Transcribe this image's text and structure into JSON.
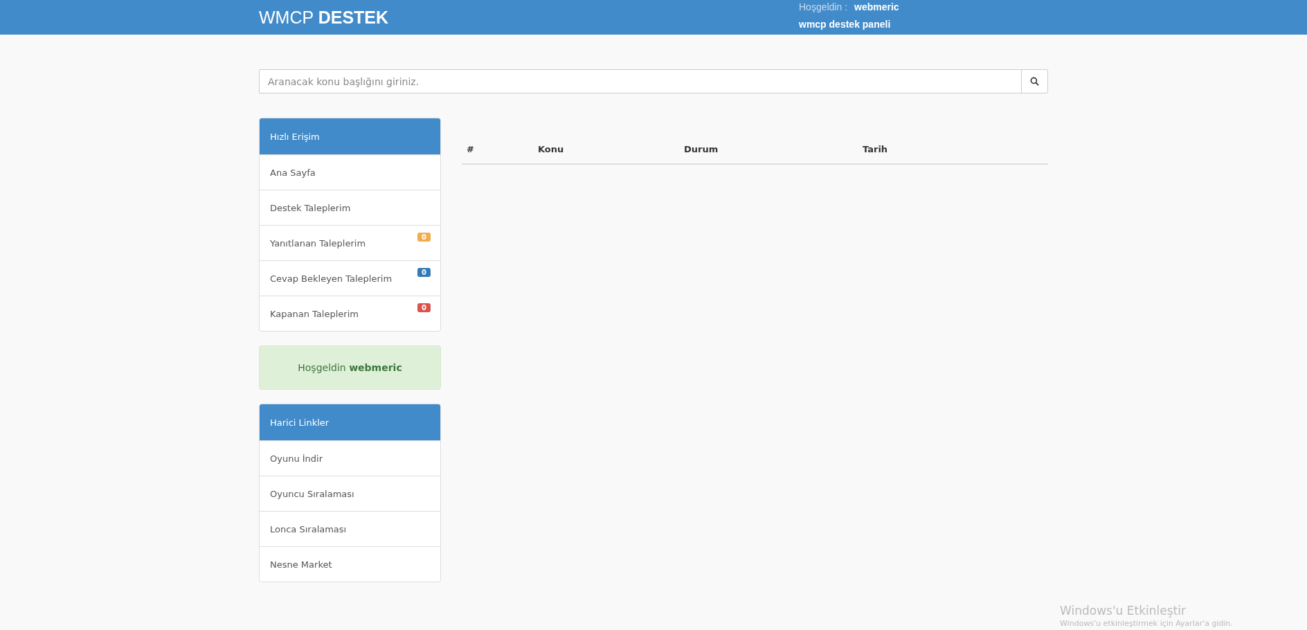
{
  "header": {
    "brand_light": "WMCP",
    "brand_bold": "DESTEK",
    "greeting_label": "Hoşgeldin :",
    "greeting_user": "webmeric",
    "subtitle": "wmcp destek paneli"
  },
  "search": {
    "placeholder": "Aranacak konu başlığını giriniz."
  },
  "quick_access": {
    "title": "Hızlı Erişim",
    "items": [
      {
        "label": "Ana Sayfa"
      },
      {
        "label": "Destek Taleplerim"
      },
      {
        "label": "Yanıtlanan Taleplerim",
        "badge": "0",
        "color": "#f0ad4e"
      },
      {
        "label": "Cevap Bekleyen Taleplerim",
        "badge": "0",
        "color": "#337ab7"
      },
      {
        "label": "Kapanan Taleplerim",
        "badge": "0",
        "color": "#d9534f"
      }
    ]
  },
  "welcome": {
    "text": "Hoşgeldin **webmeric**"
  },
  "external_links": {
    "title": "Harici Linkler",
    "items": [
      {
        "label": "Oyunu İndir"
      },
      {
        "label": "Oyuncu Sıralaması"
      },
      {
        "label": "Lonca Sıralaması"
      },
      {
        "label": "Nesne Market"
      }
    ]
  },
  "table": {
    "columns": [
      "#",
      "Konu",
      "Durum",
      "Tarih"
    ]
  },
  "os_notice": {
    "title": "Windows'u Etkinleştir",
    "text": "Windows'u etkinleştirmek için Ayarlar'a gidin."
  }
}
